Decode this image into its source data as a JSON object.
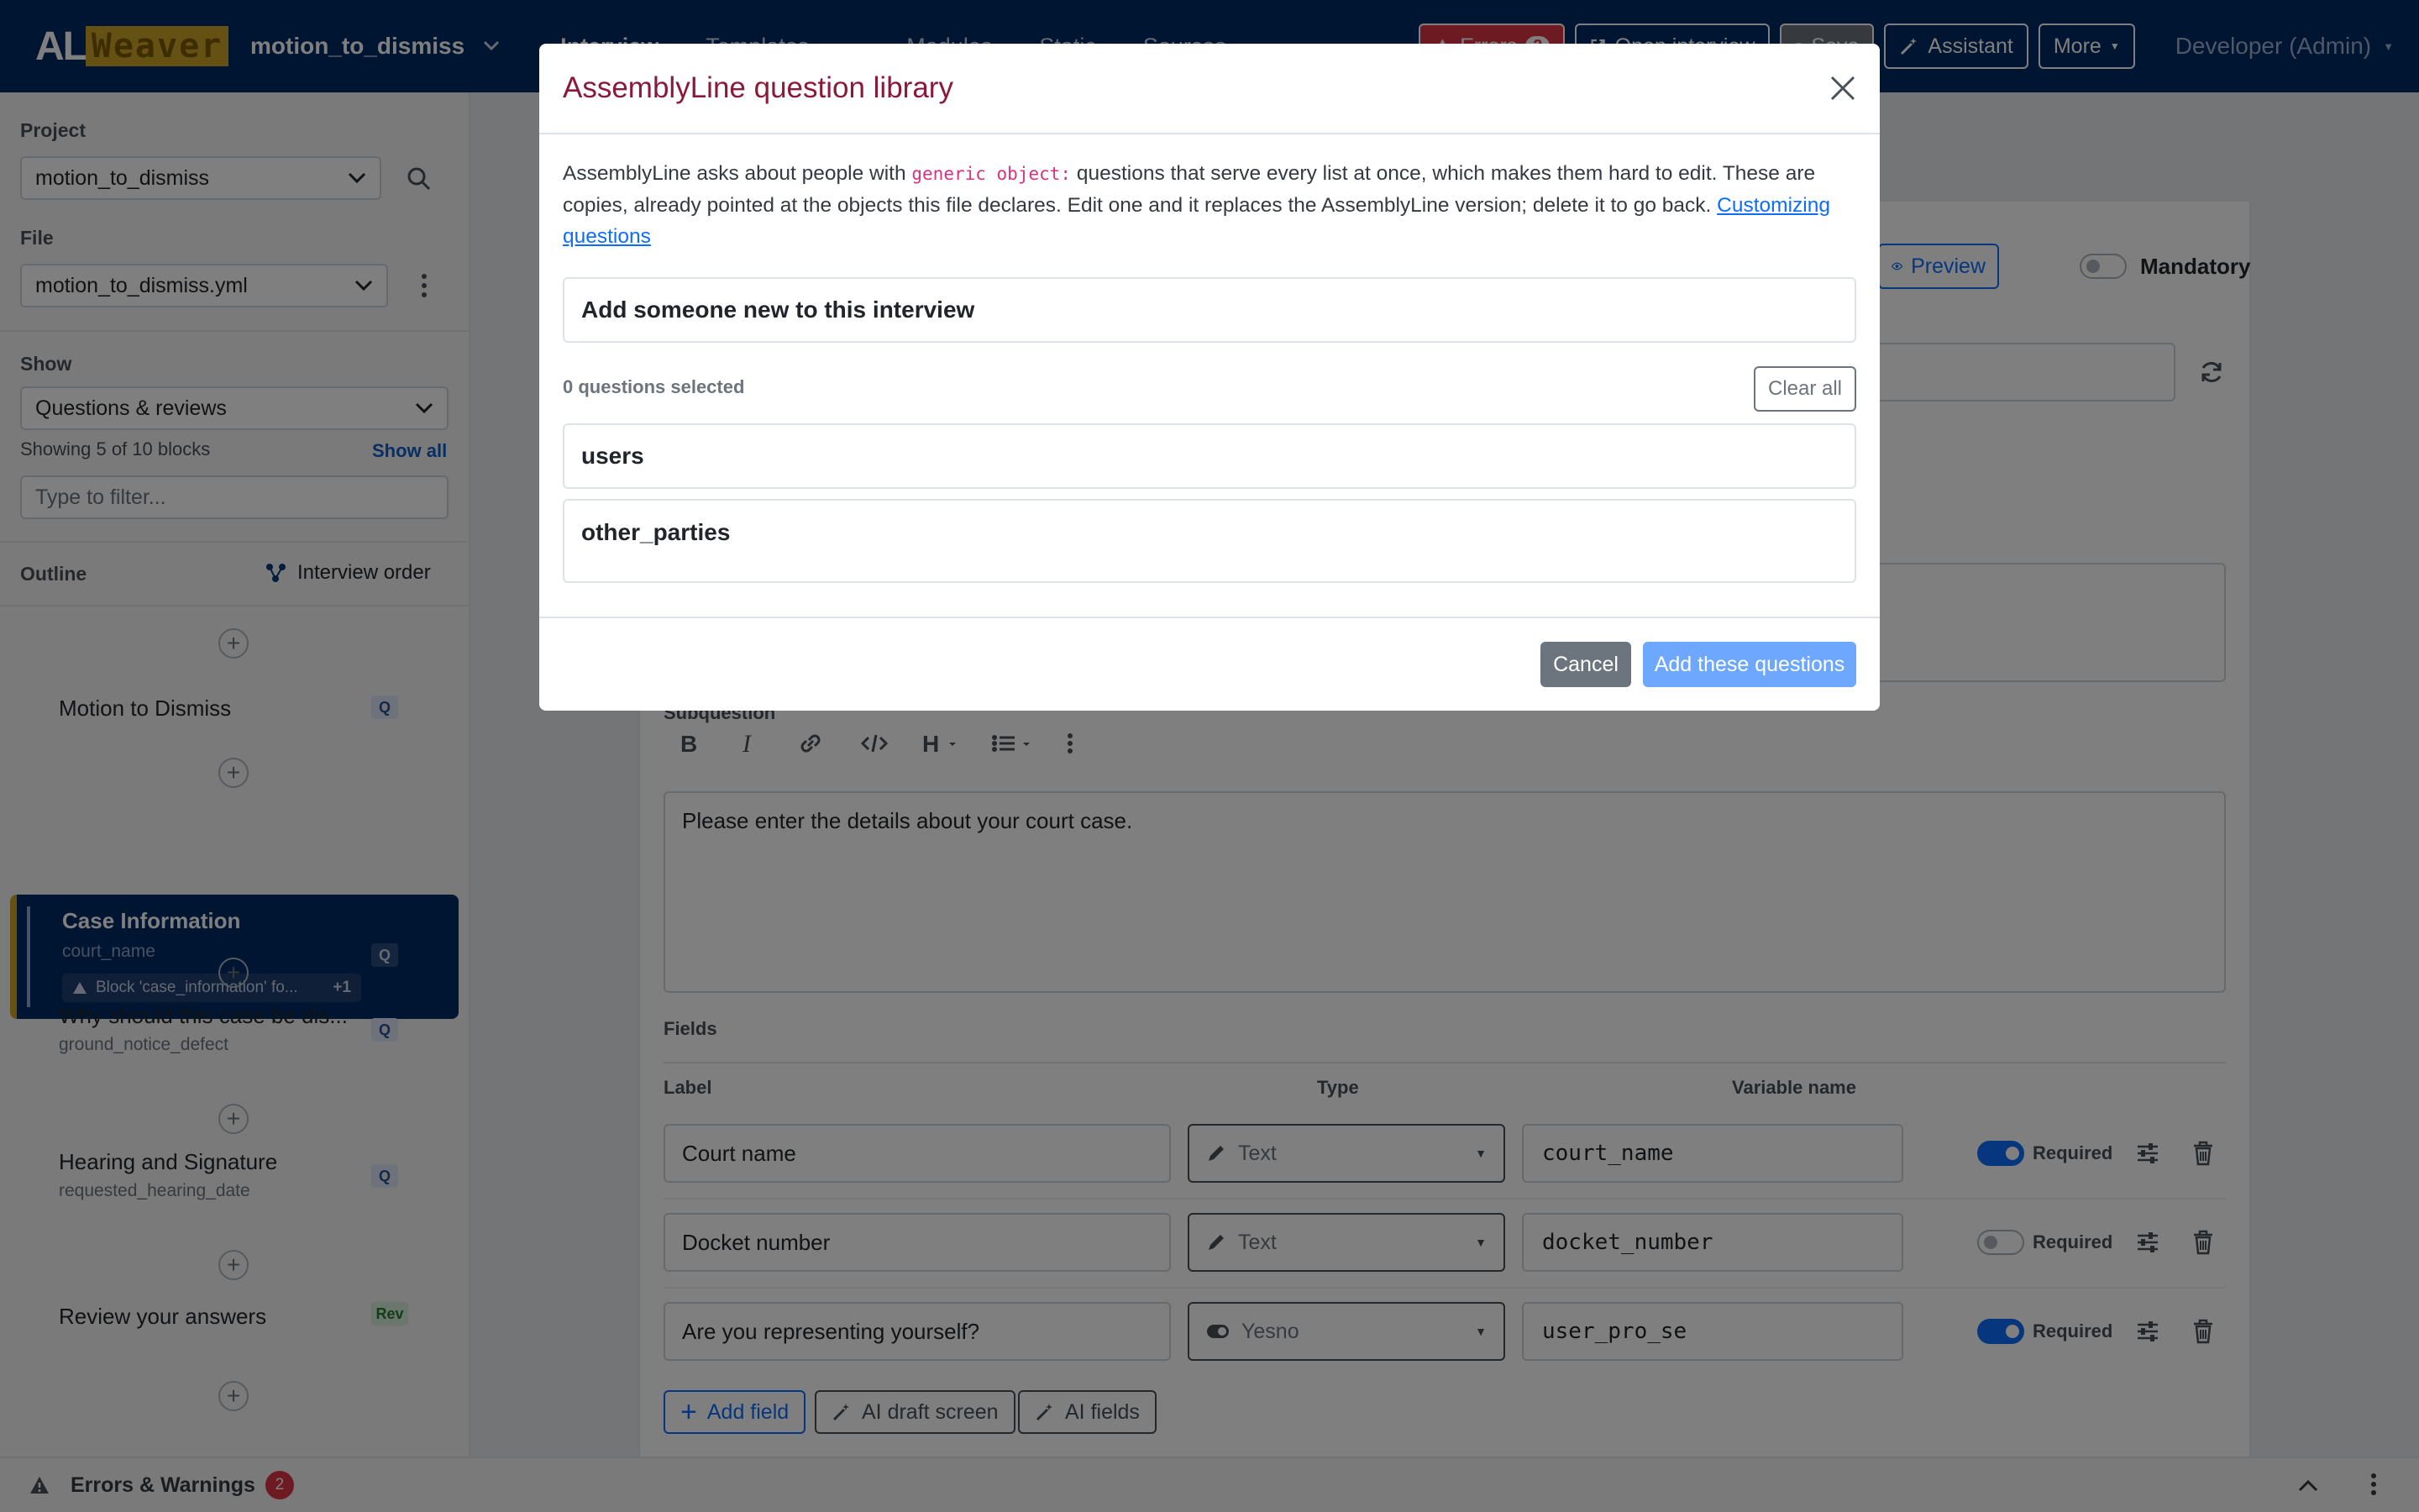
{
  "navbar": {
    "logo_al": "AL",
    "logo_weaver": "Weaver",
    "project_title": "motion_to_dismiss",
    "tabs": [
      "Interview",
      "Templates",
      "Modules",
      "Static",
      "Sources"
    ],
    "errors_label": "Errors",
    "errors_count": "2",
    "open_interview_label": "Open interview",
    "save_label": "Save",
    "assistant_label": "Assistant",
    "more_label": "More",
    "user_label": "Developer (Admin)"
  },
  "sidebar": {
    "project_label": "Project",
    "project_value": "motion_to_dismiss",
    "file_label": "File",
    "file_value": "motion_to_dismiss.yml",
    "show_label": "Show",
    "show_value": "Questions & reviews",
    "showing_text": "Showing 5 of 10 blocks",
    "show_all_label": "Show all",
    "filter_placeholder": "Type to filter...",
    "outline_label": "Outline",
    "interview_order_label": "Interview order",
    "items": [
      {
        "title": "Motion to Dismiss",
        "sub": "",
        "badge": "Q"
      },
      {
        "title": "Case Information",
        "sub": "court_name",
        "badge": "Q",
        "warning": "Block 'case_information' fo...",
        "warning_extra": "+1"
      },
      {
        "title": "Why should this case be dis...",
        "sub": "ground_notice_defect",
        "badge": "Q"
      },
      {
        "title": "Hearing and Signature",
        "sub": "requested_hearing_date",
        "badge": "Q"
      },
      {
        "title": "Review your answers",
        "sub": "",
        "badge": "Rev"
      }
    ]
  },
  "editor": {
    "preview_label": "Preview",
    "mandatory_label": "Mandatory",
    "subquestion_label": "Subquestion",
    "subquestion_text": "Please enter the details about your court case.",
    "fields_label": "Fields",
    "col_label": "Label",
    "col_type": "Type",
    "col_variable": "Variable name",
    "required_label": "Required",
    "fields": [
      {
        "label": "Court name",
        "type": "Text",
        "variable": "court_name",
        "required": true
      },
      {
        "label": "Docket number",
        "type": "Text",
        "variable": "docket_number",
        "required": false
      },
      {
        "label": "Are you representing yourself?",
        "type": "Yesno",
        "variable": "user_pro_se",
        "required": true
      }
    ],
    "add_field_label": "Add field",
    "ai_draft_label": "AI draft screen",
    "ai_fields_label": "AI fields"
  },
  "statusbar": {
    "label": "Errors & Warnings",
    "count": "2"
  },
  "modal": {
    "title": "AssemblyLine question library",
    "desc_part1": "AssemblyLine asks about people with ",
    "desc_code": "generic object:",
    "desc_part2": " questions that serve every list at once, which makes them hard to edit. These are copies, already pointed at the objects this file declares. Edit one and it replaces the AssemblyLine version; delete it to go back. ",
    "desc_link": "Customizing questions",
    "add_someone_label": "Add someone new to this interview",
    "selected_count_text": "0 questions selected",
    "clear_all_label": "Clear all",
    "groups": [
      "users",
      "other_parties"
    ],
    "cancel_label": "Cancel",
    "add_label": "Add these questions"
  },
  "colors": {
    "navbar": "#002a63",
    "accent_gold": "#c9a227",
    "modal_title": "#8b1a3a",
    "primary": "#0d6efd",
    "danger": "#dc3545"
  }
}
